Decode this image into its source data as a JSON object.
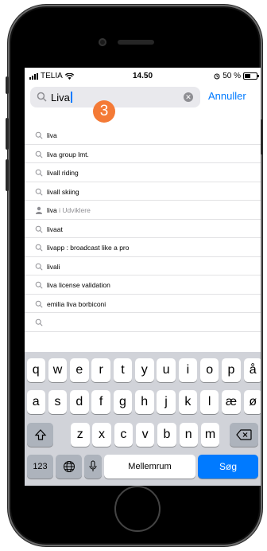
{
  "status": {
    "carrier": "TELIA",
    "time": "14.50",
    "battery": "50 %"
  },
  "search": {
    "query": "Liva",
    "cancel_label": "Annuller"
  },
  "step_badge": "3",
  "suggestions": [
    {
      "text": "liva",
      "sub": "",
      "icon": "search-icon"
    },
    {
      "text": "liva group lmt.",
      "sub": "",
      "icon": "search-icon"
    },
    {
      "text": "livall riding",
      "sub": "",
      "icon": "search-icon"
    },
    {
      "text": "livall skiing",
      "sub": "",
      "icon": "search-icon"
    },
    {
      "text": "liva",
      "sub": " i Udviklere",
      "icon": "person-icon"
    },
    {
      "text": "livaat",
      "sub": "",
      "icon": "search-icon"
    },
    {
      "text": "livapp : broadcast like a pro",
      "sub": "",
      "icon": "search-icon"
    },
    {
      "text": "livali",
      "sub": "",
      "icon": "search-icon"
    },
    {
      "text": "liva license validation",
      "sub": "",
      "icon": "search-icon"
    },
    {
      "text": "emilia liva borbiconi",
      "sub": "",
      "icon": "search-icon"
    },
    {
      "text": "",
      "sub": "",
      "icon": "search-icon"
    }
  ],
  "keyboard": {
    "row1": [
      "q",
      "w",
      "e",
      "r",
      "t",
      "y",
      "u",
      "i",
      "o",
      "p",
      "å"
    ],
    "row2": [
      "a",
      "s",
      "d",
      "f",
      "g",
      "h",
      "j",
      "k",
      "l",
      "æ",
      "ø"
    ],
    "row3": [
      "z",
      "x",
      "c",
      "v",
      "b",
      "n",
      "m"
    ],
    "numbers_label": "123",
    "space_label": "Mellemrum",
    "search_label": "Søg"
  }
}
